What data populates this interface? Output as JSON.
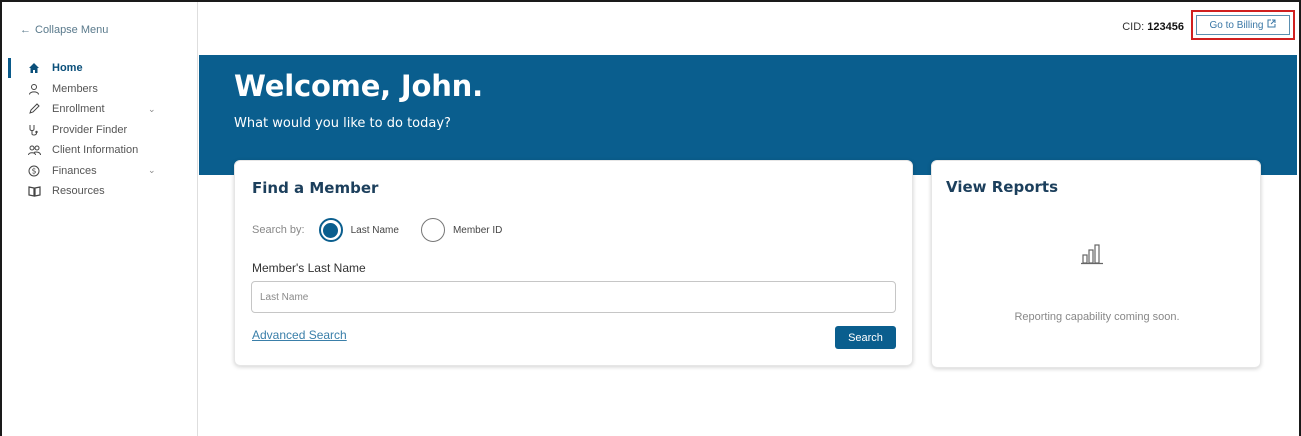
{
  "sidebar": {
    "collapse_label": "Collapse Menu",
    "items": [
      {
        "label": "Home",
        "icon": "home-icon",
        "active": true
      },
      {
        "label": "Members",
        "icon": "person-icon"
      },
      {
        "label": "Enrollment",
        "icon": "pencil-icon",
        "has_submenu": true
      },
      {
        "label": "Provider Finder",
        "icon": "stethoscope-icon"
      },
      {
        "label": "Client Information",
        "icon": "group-icon"
      },
      {
        "label": "Finances",
        "icon": "dollar-circle-icon",
        "has_submenu": true
      },
      {
        "label": "Resources",
        "icon": "book-icon"
      }
    ]
  },
  "topbar": {
    "cid_label": "CID:",
    "cid_value": "123456",
    "billing_label": "Go to Billing"
  },
  "hero": {
    "title": "Welcome, John.",
    "subtitle": "What would you like to do today?"
  },
  "find_member": {
    "title": "Find a Member",
    "search_by_label": "Search by:",
    "options": [
      {
        "label": "Last Name",
        "checked": true
      },
      {
        "label": "Member ID",
        "checked": false
      }
    ],
    "field_label": "Member's Last Name",
    "placeholder": "Last Name",
    "advanced_link": "Advanced Search",
    "search_button": "Search"
  },
  "reports": {
    "title": "View Reports",
    "message": "Reporting capability coming soon."
  },
  "colors": {
    "brand": "#0a5e8e",
    "highlight": "#d02020",
    "link": "#3a7fa9"
  }
}
